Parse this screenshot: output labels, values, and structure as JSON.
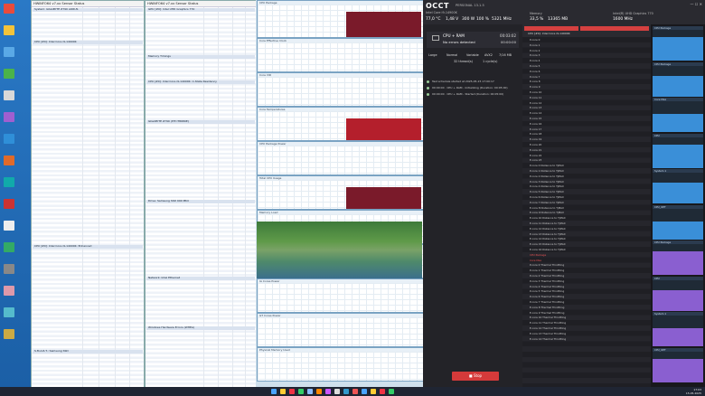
{
  "desktop": {
    "icons": [
      "app-icon-1",
      "app-icon-2",
      "app-icon-3",
      "app-icon-4",
      "app-icon-5",
      "app-icon-6",
      "app-icon-7",
      "app-icon-8",
      "app-icon-9",
      "app-icon-10",
      "app-icon-11",
      "app-icon-12",
      "app-icon-13",
      "app-icon-14",
      "app-icon-15",
      "app-icon-16"
    ]
  },
  "hwinfo_left": {
    "title": "HWiNFO64 v7.xx Sensor Status",
    "groups": [
      "System: GIGABYTE Z790 AORUS",
      "CPU [#0]: Intel Core i9-14900K",
      "CPU [#0]: Intel Core i9-14900K: Enhanced",
      "S.M.A.R.T.: Samsung SSD"
    ]
  },
  "hwinfo_right": {
    "title": "HWiNFO64 v7.xx Sensor Status",
    "groups": [
      "GPU [#0]: Intel UHD Graphics 770",
      "Memory Timings",
      "CPU [#0]: Intel Core i9-14900K: C-State Residency",
      "GIGABYTE Z790 (ITE IT8689E)",
      "Drive: Samsung SSD 990 PRO",
      "Network: Intel Ethernet",
      "Windows Hardware Errors (WHEA)"
    ]
  },
  "graphs": {
    "headers": [
      "CPU Package",
      "Core Effective Clock",
      "Core VID",
      "Core Temperatures",
      "CPU Package Power",
      "Total CPU Usage",
      "Memory Load",
      "Core Max",
      "IA Cores Power",
      "GT Cores Power",
      "Physical Memory Used"
    ]
  },
  "occt": {
    "logo_main": "OCCT",
    "logo_suffix": "",
    "edition": "PERSONAL 13.1.5",
    "cpu_name": "Intel Core i9-14900K",
    "stats": [
      "77,0 °C",
      "1,48 V",
      "300 W",
      "100 %",
      "5321 MHz"
    ],
    "memory_label": "Memory",
    "memory_stats": [
      "33,5 %",
      "13365 MB"
    ],
    "gpu_label": "Intel(R) UHD Graphics 770",
    "gpu_stats": [
      "1600 MHz"
    ],
    "test_name": "CPU + RAM",
    "test_time": "00:03:02",
    "status": "No errors detected",
    "status_time": "00:00:00",
    "param_labels": [
      "Large",
      "Normal",
      "Variable",
      "AVX2",
      "7/16 MB"
    ],
    "param_values": [
      "32 thread(s)",
      "1 cycle(s)"
    ],
    "log": [
      "Test schedule started at 2025-05-15 17:00:17",
      "00:00:00 · CPU + RAM - Initializing (Duration: 00:05:00)",
      "00:00:00 · CPU + RAM - Started (Duration: 00:05:00)"
    ],
    "stop_label": "Stop"
  },
  "monitor": {
    "header": "CPU [#0]: Intel Core i9-14900K",
    "rows": [
      "P-core 0",
      "P-core 1",
      "P-core 2",
      "P-core 3",
      "P-core 4",
      "P-core 5",
      "P-core 6",
      "P-core 7",
      "E-core 8",
      "E-core 9",
      "E-core 10",
      "E-core 11",
      "E-core 12",
      "E-core 13",
      "E-core 14",
      "E-core 15",
      "E-core 16",
      "E-core 17",
      "E-core 18",
      "E-core 19",
      "E-core 20",
      "E-core 21",
      "E-core 22",
      "E-core 23",
      "P-core 0 Distance to TjMAX",
      "P-core 1 Distance to TjMAX",
      "P-core 2 Distance to TjMAX",
      "P-core 3 Distance to TjMAX",
      "P-core 4 Distance to TjMAX",
      "P-core 5 Distance to TjMAX",
      "P-core 6 Distance to TjMAX",
      "P-core 7 Distance to TjMAX",
      "E-core 8 Distance to TjMAX",
      "E-core 9 Distance to TjMAX",
      "E-core 10 Distance to TjMAX",
      "E-core 11 Distance to TjMAX",
      "E-core 12 Distance to TjMAX",
      "E-core 13 Distance to TjMAX",
      "E-core 14 Distance to TjMAX",
      "E-core 15 Distance to TjMAX",
      "E-core 16 Distance to TjMAX",
      "CPU Package",
      "Core Max",
      "P-core 0 Thermal Throttling",
      "P-core 1 Thermal Throttling",
      "P-core 2 Thermal Throttling",
      "P-core 3 Thermal Throttling",
      "P-core 4 Thermal Throttling",
      "P-core 5 Thermal Throttling",
      "P-core 6 Thermal Throttling",
      "P-core 7 Thermal Throttling",
      "E-core 8 Thermal Throttling",
      "E-core 9 Thermal Throttling",
      "E-core 10 Thermal Throttling",
      "E-core 11 Thermal Throttling",
      "E-core 12 Thermal Throttling",
      "E-core 13 Thermal Throttling",
      "E-core 14 Thermal Throttling"
    ]
  },
  "mini_graphs": {
    "labels": [
      "CPU Package",
      "CPU Package",
      "Core Max",
      "CPU",
      "System 1",
      "CPU_OPT",
      "CPU Package",
      "CPU",
      "System 1",
      "CPU_OPT"
    ],
    "colors": [
      "#3a8fd8",
      "#3a8fd8",
      "#3a8fd8",
      "#3a8fd8",
      "#3a8fd8",
      "#3a8fd8",
      "#8a5fd0",
      "#8a5fd0",
      "#8a5fd0",
      "#8a5fd0"
    ]
  },
  "taskbar": {
    "time": "17:03",
    "date": "15.05.2025"
  }
}
